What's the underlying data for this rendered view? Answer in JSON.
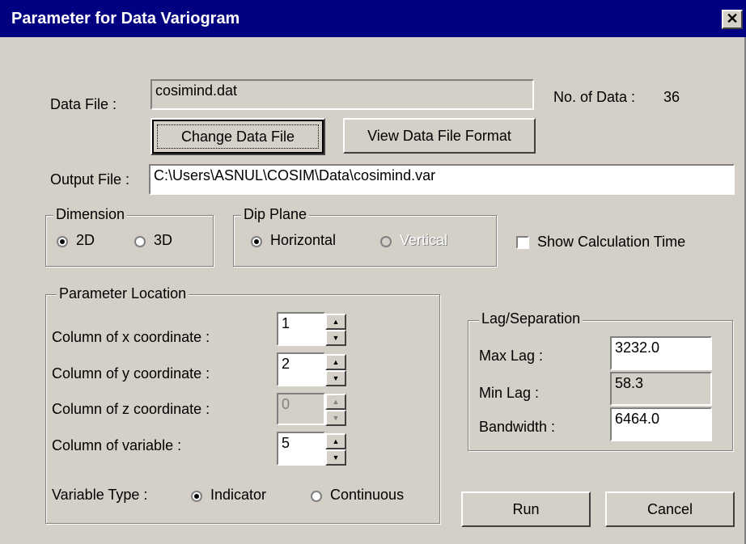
{
  "window": {
    "title": "Parameter for Data Variogram",
    "close_symbol": "✕"
  },
  "data_file": {
    "label": "Data File :",
    "value": "cosimind.dat",
    "no_of_data_label": "No. of Data :",
    "no_of_data_value": "36",
    "change_button": "Change Data File",
    "view_button": "View Data File Format"
  },
  "output_file": {
    "label": "Output File :",
    "value": "C:\\Users\\ASNUL\\COSIM\\Data\\cosimind.var"
  },
  "dimension": {
    "legend": "Dimension",
    "options": [
      "2D",
      "3D"
    ],
    "selected": "2D"
  },
  "dip_plane": {
    "legend": "Dip Plane",
    "options": [
      "Horizontal",
      "Vertical"
    ],
    "selected": "Horizontal"
  },
  "show_calc_time": {
    "label": "Show Calculation Time",
    "checked": false
  },
  "parameter_location": {
    "legend": "Parameter Location",
    "rows": [
      {
        "label": "Column of x coordinate :",
        "value": "1",
        "enabled": true
      },
      {
        "label": "Column of y coordinate :",
        "value": "2",
        "enabled": true
      },
      {
        "label": "Column of z coordinate :",
        "value": "0",
        "enabled": false
      },
      {
        "label": "Column of variable :",
        "value": "5",
        "enabled": true
      }
    ],
    "variable_type_label": "Variable Type :",
    "variable_type_options": [
      "Indicator",
      "Continuous"
    ],
    "variable_type_selected": "Indicator"
  },
  "lag": {
    "legend": "Lag/Separation",
    "max_lag_label": "Max Lag :",
    "max_lag_value": "3232.0",
    "min_lag_label": "Min Lag :",
    "min_lag_value": "58.3",
    "bandwidth_label": "Bandwidth :",
    "bandwidth_value": "6464.0"
  },
  "buttons": {
    "run": "Run",
    "cancel": "Cancel"
  },
  "colors": {
    "titlebar": "#000080",
    "dialog": "#d4d0c8"
  }
}
